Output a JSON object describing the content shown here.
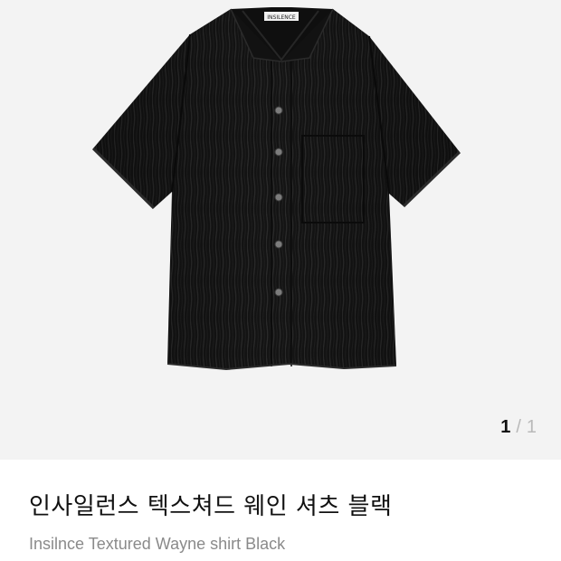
{
  "gallery": {
    "image_subject": "black textured short-sleeve button shirt",
    "pager": {
      "current": "1",
      "separator": "/",
      "total": "1"
    },
    "colors": {
      "background": "#f3f3f3",
      "shirt": "#151515"
    }
  },
  "product": {
    "name_ko": "인사일런스 텍스쳐드 웨인 셔츠 블랙",
    "name_en": "Insilnce Textured Wayne shirt Black",
    "label_tag": "INSILENCE"
  }
}
